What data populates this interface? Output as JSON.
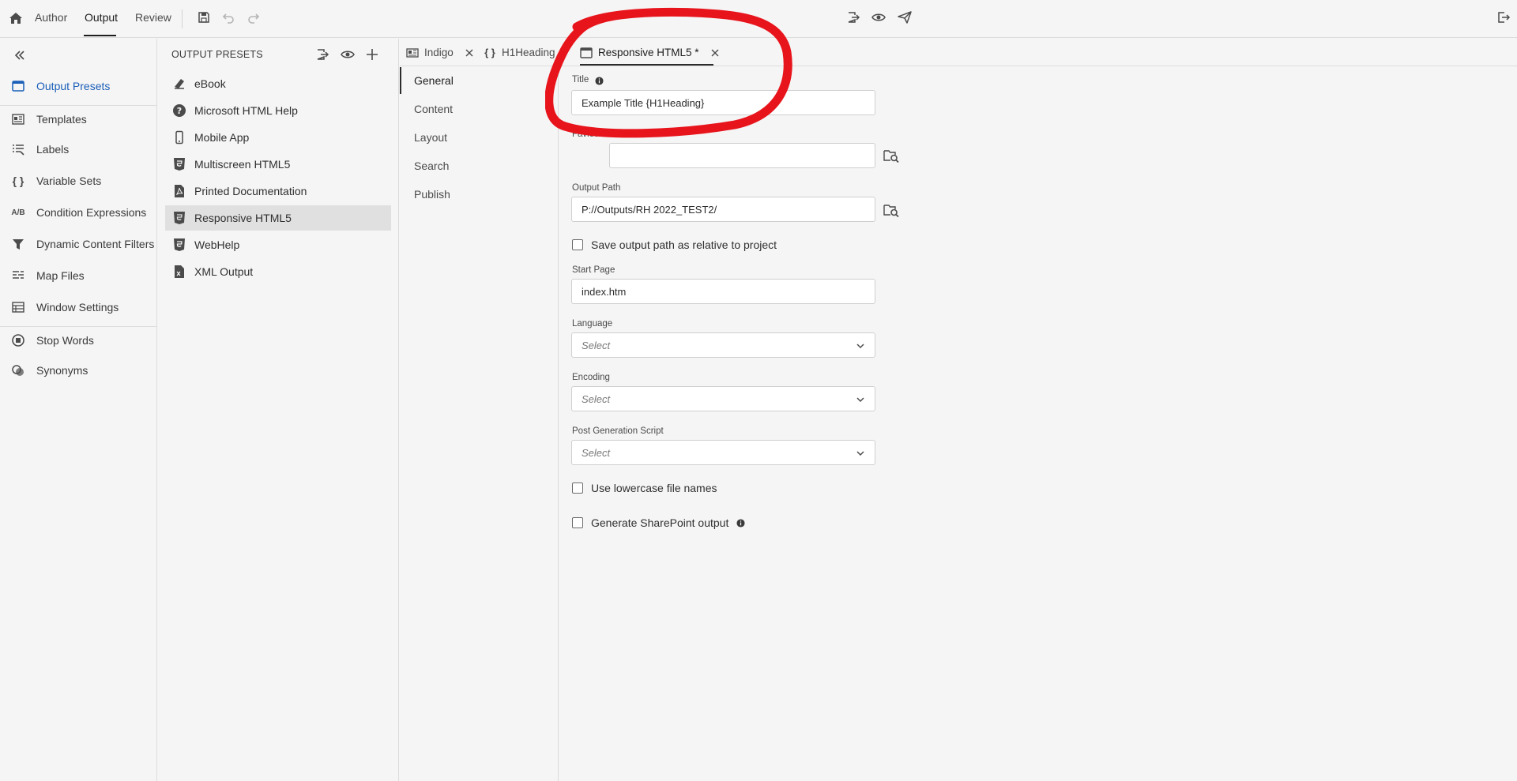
{
  "topbar": {
    "tabs": [
      {
        "label": "Author",
        "active": false
      },
      {
        "label": "Output",
        "active": true
      },
      {
        "label": "Review",
        "active": false
      }
    ],
    "icons": [
      "home-icon",
      "save-icon",
      "undo-icon",
      "redo-icon",
      "generate-icon",
      "preview-icon",
      "publish-icon",
      "exit-icon"
    ]
  },
  "leftnav": {
    "items": [
      {
        "label": "Output Presets",
        "icon": "output-presets-icon",
        "active": true
      },
      {
        "label": "Templates",
        "icon": "templates-icon"
      },
      {
        "label": "Labels",
        "icon": "labels-icon"
      },
      {
        "label": "Variable Sets",
        "icon": "braces-icon"
      },
      {
        "label": "Condition Expressions",
        "icon": "ab-icon"
      },
      {
        "label": "Dynamic Content Filters",
        "icon": "filter-icon"
      },
      {
        "label": "Map Files",
        "icon": "map-files-icon"
      },
      {
        "label": "Window Settings",
        "icon": "window-settings-icon"
      },
      {
        "label": "Stop Words",
        "icon": "stop-icon"
      },
      {
        "label": "Synonyms",
        "icon": "synonyms-icon"
      }
    ],
    "ab_glyph": "A/B",
    "braces_glyph": "{ }"
  },
  "presets": {
    "title": "OUTPUT PRESETS",
    "items": [
      {
        "label": "eBook",
        "icon": "ebook-icon"
      },
      {
        "label": "Microsoft HTML Help",
        "icon": "help-icon"
      },
      {
        "label": "Mobile App",
        "icon": "mobile-icon"
      },
      {
        "label": "Multiscreen HTML5",
        "icon": "html5-icon"
      },
      {
        "label": "Printed Documentation",
        "icon": "pdf-icon"
      },
      {
        "label": "Responsive HTML5",
        "icon": "html5-icon",
        "selected": true
      },
      {
        "label": "WebHelp",
        "icon": "html5-icon"
      },
      {
        "label": "XML Output",
        "icon": "xml-icon"
      }
    ]
  },
  "editor_tabs": [
    {
      "label": "Indigo",
      "icon": "template-icon"
    },
    {
      "label": "H1Heading",
      "icon": "braces-icon"
    },
    {
      "label": "Responsive HTML5 *",
      "icon": "output-presets-icon",
      "active": true
    }
  ],
  "subnav": [
    "General",
    "Content",
    "Layout",
    "Search",
    "Publish"
  ],
  "form": {
    "title_label": "Title",
    "title_value": "Example Title {H1Heading}",
    "favicon_label": "Favicon",
    "favicon_value": "",
    "output_path_label": "Output Path",
    "output_path_value": "P://Outputs/RH 2022_TEST2/",
    "save_relative_label": "Save output path as relative to project",
    "start_page_label": "Start Page",
    "start_page_value": "index.htm",
    "language_label": "Language",
    "language_value": "Select",
    "encoding_label": "Encoding",
    "encoding_value": "Select",
    "post_gen_label": "Post Generation Script",
    "post_gen_value": "Select",
    "lowercase_label": "Use lowercase file names",
    "sharepoint_label": "Generate SharePoint output"
  },
  "colors": {
    "accent": "#1b5fb8",
    "annotation": "#e8141c"
  }
}
